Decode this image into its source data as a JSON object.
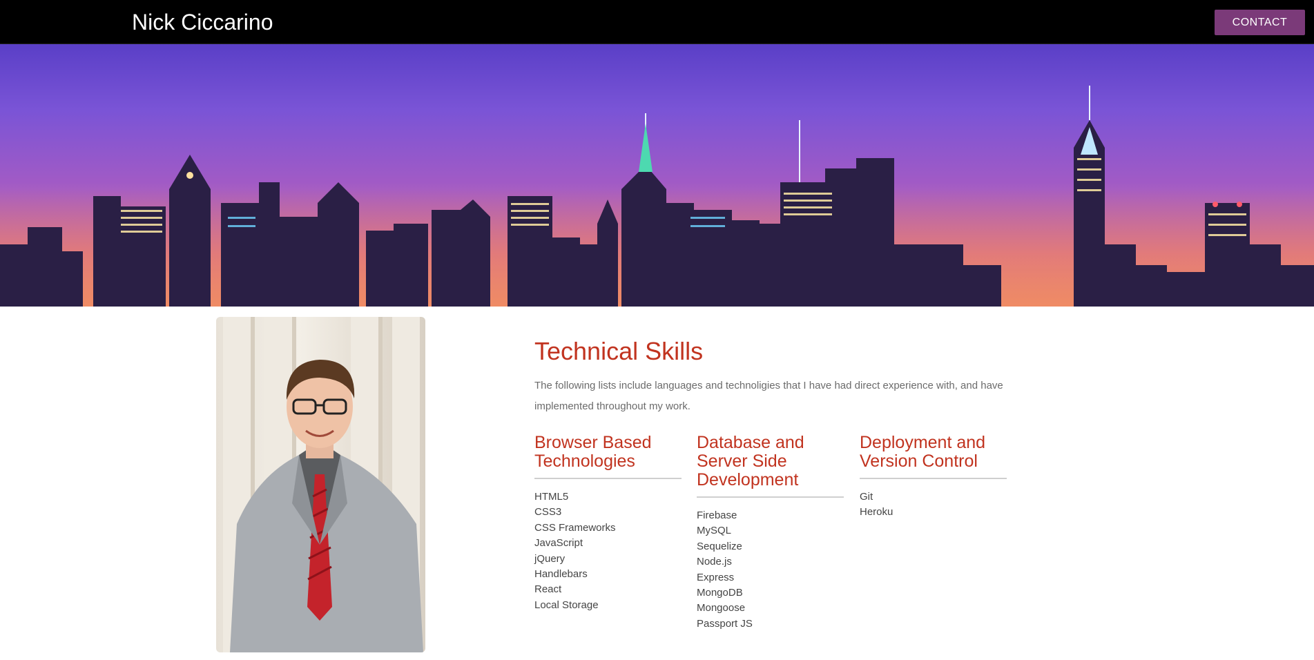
{
  "header": {
    "brand": "Nick Ciccarino",
    "contact_label": "CONTACT"
  },
  "hero": {
    "image": "new-york-skyline-at-night",
    "colors": {
      "sky_top": "#5a3fc7",
      "sky_bottom": "#e36a60"
    }
  },
  "profile": {
    "photo": "portrait-man-in-grey-suit-red-tie"
  },
  "skills": {
    "title": "Technical Skills",
    "intro": "The following lists include languages and technoligies that I have had direct experience with, and have implemented throughout my work.",
    "columns": [
      {
        "heading": "Browser Based Technologies",
        "items": [
          "HTML5",
          "CSS3",
          "CSS Frameworks",
          "JavaScript",
          "jQuery",
          "Handlebars",
          "React",
          "Local Storage"
        ]
      },
      {
        "heading": "Database and Server Side Development",
        "items": [
          "Firebase",
          "MySQL",
          "Sequelize",
          "Node.js",
          "Express",
          "MongoDB",
          "Mongoose",
          "Passport JS"
        ]
      },
      {
        "heading": "Deployment and Version Control",
        "items": [
          "Git",
          "Heroku"
        ]
      }
    ]
  },
  "colors": {
    "accent": "#c1331f",
    "button": "#7b3a79",
    "navbar": "#000000"
  }
}
